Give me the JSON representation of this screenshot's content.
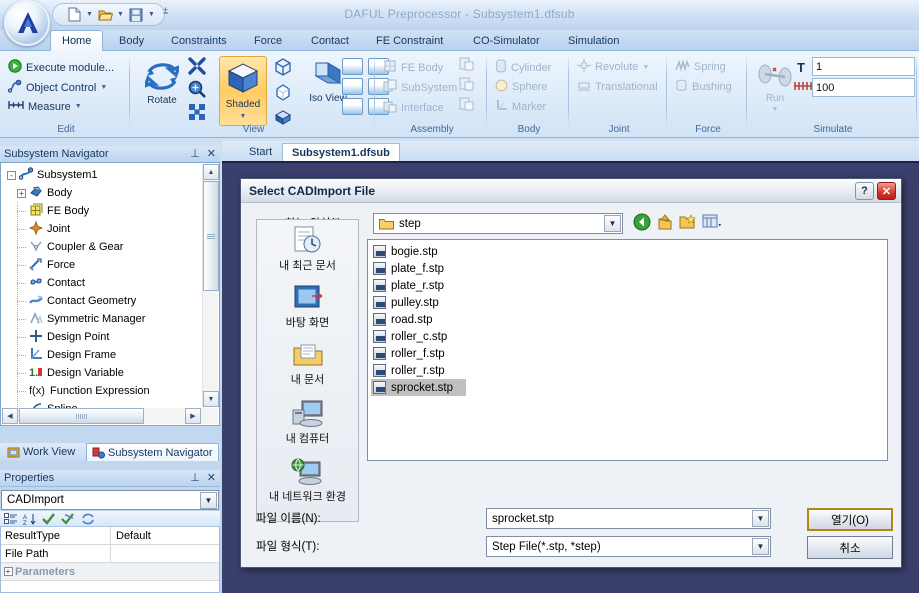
{
  "window": {
    "title": "DAFUL Preprocessor - Subsystem1.dfsub",
    "orb_label": "A"
  },
  "quick_access": {
    "new_label": "New",
    "open_label": "Open",
    "save_label": "Save",
    "more_label": "Customize Quick Access Toolbar"
  },
  "ribbon": {
    "tabs": [
      {
        "label": "Home",
        "active": true
      },
      {
        "label": "Body",
        "active": false
      },
      {
        "label": "Constraints",
        "active": false
      },
      {
        "label": "Force",
        "active": false
      },
      {
        "label": "Contact",
        "active": false
      },
      {
        "label": "FE Constraint",
        "active": false
      },
      {
        "label": "CO-Simulator",
        "active": false
      },
      {
        "label": "Simulation",
        "active": false
      }
    ],
    "groups": {
      "edit": {
        "label": "Edit",
        "items": [
          {
            "label": "Execute module...",
            "icon": "play-icon"
          },
          {
            "label": "Object Control",
            "icon": "object-control-icon"
          },
          {
            "label": "Measure",
            "icon": "measure-icon"
          }
        ]
      },
      "view": {
        "label": "View",
        "rotate_label": "Rotate",
        "shaded_label": "Shaded",
        "iso_label": "Iso View"
      },
      "assembly": {
        "label": "Assembly",
        "items": [
          {
            "label": "FE Body"
          },
          {
            "label": "SubSystem"
          },
          {
            "label": "Interface"
          }
        ]
      },
      "body": {
        "label": "Body",
        "items": [
          {
            "label": "Cylinder"
          },
          {
            "label": "Sphere"
          },
          {
            "label": "Marker"
          }
        ]
      },
      "joint": {
        "label": "Joint",
        "items": [
          {
            "label": "Revolute"
          },
          {
            "label": "Translational"
          }
        ]
      },
      "force": {
        "label": "Force",
        "items": [
          {
            "label": "Spring"
          },
          {
            "label": "Bushing"
          }
        ]
      },
      "simulate": {
        "label": "Simulate",
        "run_label": "Run",
        "time_value": "1",
        "step_value": "100"
      }
    }
  },
  "navigator": {
    "title": "Subsystem Navigator",
    "tree": [
      {
        "label": "Subsystem1",
        "level": 0,
        "expander": "-",
        "icon": "subsystem-icon"
      },
      {
        "label": "Body",
        "level": 1,
        "expander": "+",
        "icon": "body-icon"
      },
      {
        "label": "FE Body",
        "level": 1,
        "expander": "",
        "icon": "fe-body-icon"
      },
      {
        "label": "Joint",
        "level": 1,
        "expander": "",
        "icon": "joint-icon"
      },
      {
        "label": "Coupler & Gear",
        "level": 1,
        "expander": "",
        "icon": "coupler-gear-icon"
      },
      {
        "label": "Force",
        "level": 1,
        "expander": "",
        "icon": "force-icon"
      },
      {
        "label": "Contact",
        "level": 1,
        "expander": "",
        "icon": "contact-icon"
      },
      {
        "label": "Contact Geometry",
        "level": 1,
        "expander": "",
        "icon": "contact-geometry-icon"
      },
      {
        "label": "Symmetric Manager",
        "level": 1,
        "expander": "",
        "icon": "symmetric-manager-icon"
      },
      {
        "label": "Design Point",
        "level": 1,
        "expander": "",
        "icon": "design-point-icon"
      },
      {
        "label": "Design Frame",
        "level": 1,
        "expander": "",
        "icon": "design-frame-icon"
      },
      {
        "label": "Design Variable",
        "level": 1,
        "expander": "",
        "icon": "design-variable-icon"
      },
      {
        "label": "Function Expression",
        "level": 1,
        "expander": "",
        "icon": "function-expression-icon"
      },
      {
        "label": "Spline",
        "level": 1,
        "expander": "",
        "icon": "spline-icon"
      }
    ]
  },
  "dock_tabs": [
    {
      "label": "Work View",
      "active": false,
      "icon": "work-view-icon"
    },
    {
      "label": "Subsystem Navigator",
      "active": true,
      "icon": "navigator-icon"
    }
  ],
  "properties": {
    "title": "Properties",
    "selected_object": "CADImport",
    "toolbar": [
      "categorize-icon",
      "sort-az-icon",
      "check-icon",
      "apply-icon",
      "refresh-icon"
    ],
    "rows": [
      {
        "name": "ResultType",
        "value": "Default"
      },
      {
        "name": "File Path",
        "value": ""
      },
      {
        "name": "Parameters",
        "value": ""
      }
    ]
  },
  "doc_tabs": [
    {
      "label": "Start",
      "active": false
    },
    {
      "label": "Subsystem1.dfsub",
      "active": true
    }
  ],
  "dialog": {
    "title": "Select CADImport File",
    "help_label": "?",
    "close_label": "✕",
    "lookin_label": "찾는 위치(I):",
    "lookin_value": "step",
    "nav_icons": [
      "back-icon",
      "up-folder-icon",
      "new-folder-icon",
      "views-icon"
    ],
    "places": [
      {
        "label": "내 최근 문서",
        "icon": "recent-documents-icon"
      },
      {
        "label": "바탕 화면",
        "icon": "desktop-icon"
      },
      {
        "label": "내 문서",
        "icon": "my-documents-icon"
      },
      {
        "label": "내 컴퓨터",
        "icon": "my-computer-icon"
      },
      {
        "label": "내 네트워크 환경",
        "icon": "network-icon"
      }
    ],
    "files": [
      {
        "name": "bogie.stp",
        "selected": false
      },
      {
        "name": "plate_f.stp",
        "selected": false
      },
      {
        "name": "plate_r.stp",
        "selected": false
      },
      {
        "name": "pulley.stp",
        "selected": false
      },
      {
        "name": "road.stp",
        "selected": false
      },
      {
        "name": "roller_c.stp",
        "selected": false
      },
      {
        "name": "roller_f.stp",
        "selected": false
      },
      {
        "name": "roller_r.stp",
        "selected": false
      },
      {
        "name": "sprocket.stp",
        "selected": true
      }
    ],
    "filename_label": "파일 이름(N):",
    "filename_value": "sprocket.stp",
    "filetype_label": "파일 형식(T):",
    "filetype_value": "Step File(*.stp, *step)",
    "open_button": "열기(O)",
    "cancel_button": "취소"
  },
  "colors": {
    "accent": "#1e4978",
    "ribbon_bg": "#e1edfa",
    "selected_tile": "#ffcb63",
    "workspace": "#3b3f6b",
    "selection_gray": "#c0c0c0"
  }
}
